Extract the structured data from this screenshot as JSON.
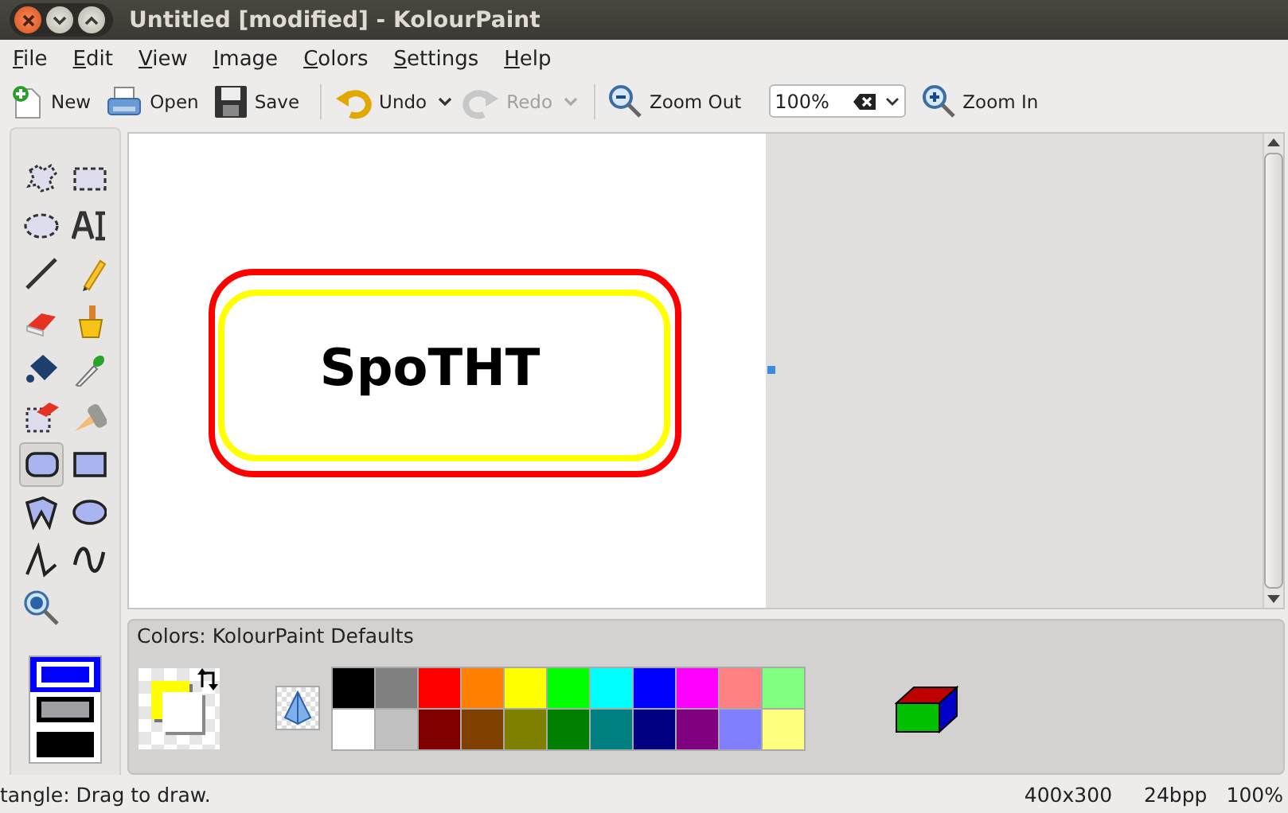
{
  "window": {
    "title": "Untitled [modified] - KolourPaint"
  },
  "menu": [
    "File",
    "Edit",
    "View",
    "Image",
    "Colors",
    "Settings",
    "Help"
  ],
  "toolbar": [
    {
      "kind": "new",
      "label": "New",
      "disabled": false
    },
    {
      "kind": "open",
      "label": "Open",
      "disabled": false
    },
    {
      "kind": "save",
      "label": "Save",
      "disabled": false
    },
    {
      "kind": "separator"
    },
    {
      "kind": "undo",
      "label": "Undo",
      "disabled": false,
      "dropdown": true
    },
    {
      "kind": "redo",
      "label": "Redo",
      "disabled": true,
      "dropdown": true
    },
    {
      "kind": "separator"
    },
    {
      "kind": "zoom-out",
      "label": "Zoom Out",
      "disabled": false
    },
    {
      "kind": "zoom-combo",
      "value": "100%"
    },
    {
      "kind": "zoom-in",
      "label": "Zoom In",
      "disabled": false
    }
  ],
  "tools": [
    {
      "kind": "free-select",
      "selected": false
    },
    {
      "kind": "rect-select",
      "selected": false
    },
    {
      "kind": "ellipse-select",
      "selected": false
    },
    {
      "kind": "text",
      "selected": false
    },
    {
      "kind": "line",
      "selected": false
    },
    {
      "kind": "pencil",
      "selected": false
    },
    {
      "kind": "eraser",
      "selected": false
    },
    {
      "kind": "brush",
      "selected": false
    },
    {
      "kind": "fill",
      "selected": false
    },
    {
      "kind": "picker",
      "selected": false
    },
    {
      "kind": "color-eraser",
      "selected": false
    },
    {
      "kind": "spray",
      "selected": false
    },
    {
      "kind": "rounded-rect",
      "selected": true
    },
    {
      "kind": "rect",
      "selected": false
    },
    {
      "kind": "polygon",
      "selected": false
    },
    {
      "kind": "ellipse",
      "selected": false
    },
    {
      "kind": "polyline",
      "selected": false
    },
    {
      "kind": "curve",
      "selected": false
    },
    {
      "kind": "zoom",
      "selected": false
    }
  ],
  "fill_styles": [
    {
      "kind": "outline",
      "selected": true
    },
    {
      "kind": "fill-bg",
      "selected": false
    },
    {
      "kind": "fill-fg",
      "selected": false
    }
  ],
  "canvas": {
    "text": "SpoTHT",
    "shapes": [
      {
        "kind": "rounded-rect",
        "color": "#ff0000"
      },
      {
        "kind": "rounded-rect",
        "color": "#ffff00"
      }
    ]
  },
  "colors": {
    "label": "Colors: KolourPaint Defaults",
    "current": [
      {
        "kind": "foreground",
        "color": "#ffff00"
      },
      {
        "kind": "background",
        "color": "#ffffff"
      }
    ],
    "palette": [
      {
        "color": "#000000"
      },
      {
        "color": "#808080"
      },
      {
        "color": "#ff0000"
      },
      {
        "color": "#ff8000"
      },
      {
        "color": "#ffff00"
      },
      {
        "color": "#00ff00"
      },
      {
        "color": "#00ffff"
      },
      {
        "color": "#0000ff"
      },
      {
        "color": "#ff00ff"
      },
      {
        "color": "#ff8080"
      },
      {
        "color": "#80ff80"
      },
      {
        "color": "#ffffff"
      },
      {
        "color": "#c0c0c0"
      },
      {
        "color": "#800000"
      },
      {
        "color": "#804000"
      },
      {
        "color": "#808000"
      },
      {
        "color": "#008000"
      },
      {
        "color": "#008080"
      },
      {
        "color": "#000080"
      },
      {
        "color": "#800080"
      },
      {
        "color": "#8080ff"
      },
      {
        "color": "#ffff80"
      }
    ]
  },
  "status_bar": {
    "message": "tangle: Drag to draw.",
    "size": "400x300",
    "depth": "24bpp",
    "zoom": "100%"
  }
}
